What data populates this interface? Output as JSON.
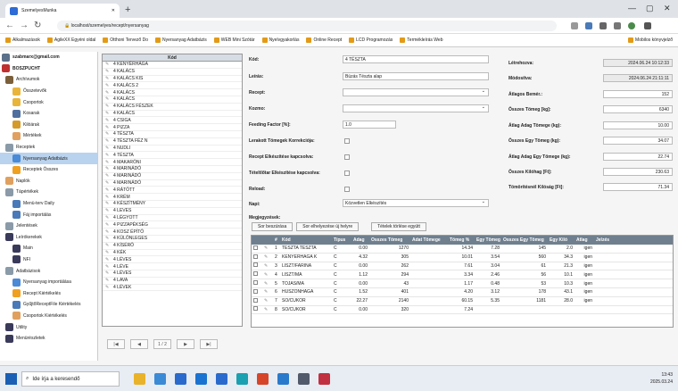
{
  "browser": {
    "tab_title": "SzemelyesMunka",
    "url": "localhost/szemelyes/recept/nyersanyag",
    "bookmarks": [
      "Alkalmazások",
      "AgileXX Egyéni oldal",
      "Otthoni Tervező Do",
      "Nyersanyag Adatbázis",
      "WEB Mini Szótár",
      "Nyelvgyakorlás",
      "Online Recept",
      "LCD Programozás",
      "Termékleírás Web",
      "Mobilos könyvjelző"
    ]
  },
  "tree": {
    "items": [
      {
        "label": "szabmarx@gmail.com",
        "color": "#5a6f8a"
      },
      {
        "label": "BOSZPUCHT",
        "color": "#c03030"
      },
      {
        "label": "Archívumok",
        "color": "#7b5f3a"
      },
      {
        "label": "Összetevők",
        "color": "#e8b43a"
      },
      {
        "label": "Csoportok",
        "color": "#e8b43a"
      },
      {
        "label": "Kosarak",
        "color": "#4f6f9f"
      },
      {
        "label": "Kilóárak",
        "color": "#d49a2a"
      },
      {
        "label": "Mértékek",
        "color": "#e0a060"
      },
      {
        "label": "Receptek",
        "color": "#8a9aa8"
      },
      {
        "label": "Nyersanyag Adatbázis",
        "color": "#4a8ad6"
      },
      {
        "label": "Receptek Összes",
        "color": "#f0a020"
      },
      {
        "label": "Naplók",
        "color": "#e0a060"
      },
      {
        "label": "Tápértékek",
        "color": "#8a9aa8"
      },
      {
        "label": "Menü-terv Daily",
        "color": "#4a7ab8"
      },
      {
        "label": "Fáj importálás",
        "color": "#4a7ab8"
      },
      {
        "label": "Jelentések",
        "color": "#8a9aa8"
      },
      {
        "label": "Leírókerekek",
        "color": "#3a3a5a"
      },
      {
        "label": "Main",
        "color": "#3a3a5a"
      },
      {
        "label": "NFI",
        "color": "#3a3a5a"
      },
      {
        "label": "Adatbázisok",
        "color": "#8a9aa8"
      },
      {
        "label": "Nyersanyag importálása",
        "color": "#4a8ad6"
      },
      {
        "label": "Recept Kiértékelés",
        "color": "#f0a020"
      },
      {
        "label": "GyűjtőReceptFile Kiértékelés",
        "color": "#4a7ab8"
      },
      {
        "label": "Csoportok Kiértékelés",
        "color": "#e0a060"
      },
      {
        "label": "Utility",
        "color": "#3a3a5a"
      },
      {
        "label": "Menürészletek",
        "color": "#3a3a5a"
      }
    ]
  },
  "grid": {
    "header": "Kód",
    "rows": [
      "4 KENYÉRHÁGA",
      "4 KALÁCS",
      "4 KALÁCS KIS",
      "4 KALÁCS 2",
      "4 KALÁCS",
      "4 KALÁCS",
      "4 KALÁCS FÉSZEK",
      "4 KALÁCS",
      "4 CSIGA",
      "4 PIZZA",
      "4 TÉSZTA",
      "4 TÉSZTA FÉZ N",
      "4 NUDLI",
      "4 TÉSZTA",
      "4 MAKARÓNI",
      "4 MARINÁDÓ",
      "4 MARINÁDÓ",
      "4 MARINÁDÓ",
      "4 RÁTŐTT",
      "4 KRÉM",
      "4 KÉSZÍTMÉNY",
      "4 LEVES",
      "4 LÉGYOTT",
      "4 PIZZAPÉKSÉG",
      "4 KOSZ ÉPÍTŐ",
      "4 KÜLÖNLEGES",
      "4 KÍSÉRŐ",
      "4 KÉK",
      "4 LÉVES",
      "4 LÉVE",
      "4 LÉVES",
      "4 LAVA",
      "4 LÉVEK"
    ],
    "pager": [
      "|◀",
      "◀",
      "1 / 2",
      "▶",
      "▶|"
    ]
  },
  "form": {
    "fields": [
      {
        "label": "Kód:",
        "value": "4 TÉSZTA"
      },
      {
        "label": "Leírás:",
        "value": "Búzás Tészta alap"
      },
      {
        "label": "Recept:",
        "value": ""
      },
      {
        "label": "Kozmo:",
        "value": ""
      },
      {
        "label": "Feeding Factor [%]:",
        "value": "1.0"
      },
      {
        "label": "Lerakott Tömegek Korrekciója:",
        "value": ""
      },
      {
        "label": "Recept Elkészítése kapcsolva:",
        "value": ""
      },
      {
        "label": "Tételtlőtar Elkészítése kapcsolva:",
        "value": ""
      },
      {
        "label": "Reload:",
        "value": ""
      },
      {
        "label": "Napi:",
        "value": "Közvetlen Elkészítés"
      },
      {
        "label": "Megjegyzések:",
        "value": ""
      }
    ],
    "stats": [
      {
        "label": "Létrehozva:",
        "value": "2024.06.24 10:12:33"
      },
      {
        "label": "Módosítva:",
        "value": "2024.06.24 21:11:11"
      },
      {
        "label": "Átlagos Bemér.:",
        "value": "152"
      },
      {
        "label": "Összes Tömeg [kg]:",
        "value": "6340"
      },
      {
        "label": "Átlag Adag Tömege (kg):",
        "value": "10.00"
      },
      {
        "label": "Összes Egy Tömeg (kg):",
        "value": "34.07"
      },
      {
        "label": "Átlag Adag Egy Tömege (kg):",
        "value": "22.74"
      },
      {
        "label": "Összes Kilóhag [Ft]:",
        "value": "230.63"
      },
      {
        "label": "Tömörítésnél Kilóság [Ft]:",
        "value": "71.34"
      }
    ],
    "buttons": [
      "Sor beszúrása",
      "Sor elhelyezése új helyre",
      "Tételek törlése együtt"
    ]
  },
  "table": {
    "columns": [
      "",
      "",
      "#",
      "Kód",
      "Típus",
      "Adag",
      "Összes Tömeg",
      "Adat Tömege",
      "Tömeg %",
      "Egy Tömeg",
      "Összes Egy Tömeg",
      "Egy Kiló",
      "Átlag",
      "Jelzés"
    ],
    "rows": [
      [
        "1",
        "TÉSZTA TÉSZTA",
        "C",
        "0.00",
        "1270",
        "",
        "14.34",
        "7.28",
        "145",
        "2.0",
        "igen"
      ],
      [
        "2",
        "KENYÉRHÁGA K",
        "C",
        "4.32",
        "305",
        "",
        "10.01",
        "3.54",
        "560",
        "34.3",
        "igen"
      ],
      [
        "3",
        "LISZT/FARINA",
        "C",
        "0.00",
        "262",
        "",
        "7.61",
        "3.04",
        "61",
        "21.3",
        "igen"
      ],
      [
        "4",
        "LISZT/MA",
        "C",
        "1.12",
        "294",
        "",
        "3.34",
        "2.46",
        "56",
        "10.1",
        "igen"
      ],
      [
        "5",
        "TOJÁS/MA",
        "C",
        "0.00",
        "43",
        "",
        "1.17",
        "0.48",
        "53",
        "10.3",
        "igen"
      ],
      [
        "6",
        "HUSZONHÁGA",
        "C",
        "1.52",
        "401",
        "",
        "4.20",
        "3.12",
        "178",
        "43.1",
        "igen"
      ],
      [
        "7",
        "SÓ/CUKOR",
        "C",
        "22.27",
        "2140",
        "",
        "60.15",
        "5.35",
        "1181",
        "28.0",
        "igen"
      ],
      [
        "8",
        "SÓ/CUKOR",
        "C",
        "0.00",
        "320",
        "",
        "7.24",
        "",
        "",
        "",
        ""
      ]
    ]
  },
  "taskbar": {
    "search_placeholder": "Ide írja a keresendő",
    "time": "13:43",
    "date": "2025.03.24",
    "icons": [
      {
        "name": "folder-icon",
        "color": "#e8b22a"
      },
      {
        "name": "photos-icon",
        "color": "#3a8ad6"
      },
      {
        "name": "calendar-icon",
        "color": "#2a6acc"
      },
      {
        "name": "store-icon",
        "color": "#1a73d0"
      },
      {
        "name": "mail-icon",
        "color": "#2a6acc"
      },
      {
        "name": "edge-icon",
        "color": "#1aa0b0"
      },
      {
        "name": "chrome-icon",
        "color": "#d6452a"
      },
      {
        "name": "code-icon",
        "color": "#2a7acc"
      },
      {
        "name": "notes-icon",
        "color": "#505a6a"
      },
      {
        "name": "app-icon",
        "color": "#c03040"
      }
    ]
  }
}
